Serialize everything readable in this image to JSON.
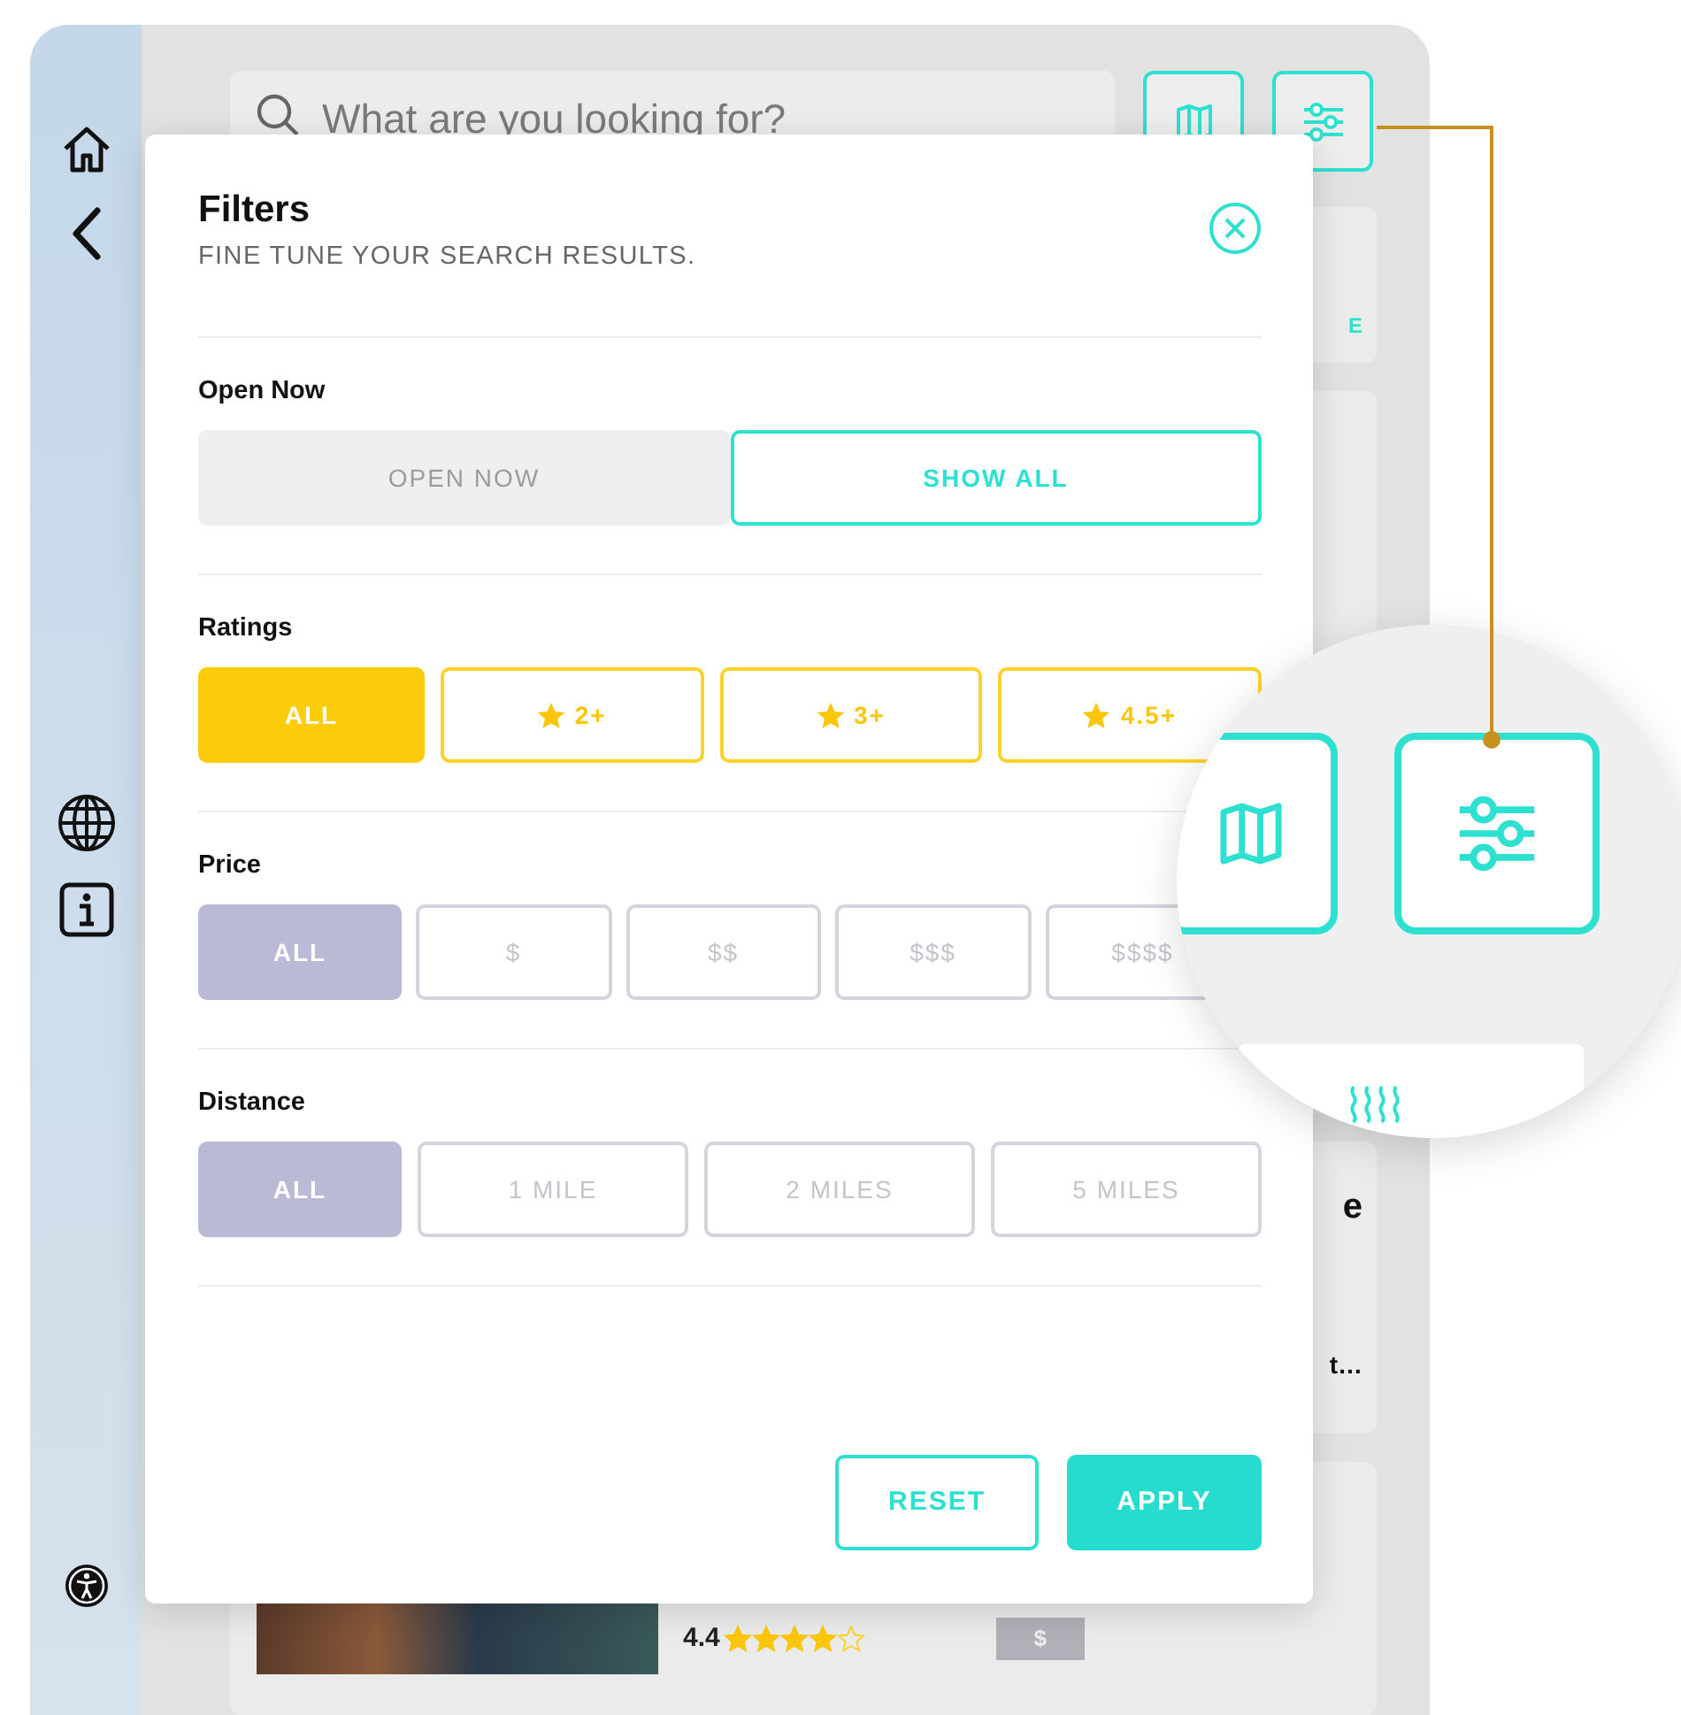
{
  "search": {
    "placeholder": "What are you looking for?"
  },
  "background_cards": [
    {
      "text": "E"
    },
    {
      "text": "e"
    },
    {
      "text": "t…"
    }
  ],
  "filters": {
    "title": "Filters",
    "subtitle": "FINE TUNE YOUR SEARCH RESULTS.",
    "sections": [
      {
        "label": "Open Now",
        "kind": "toggle",
        "options": [
          {
            "label": "OPEN NOW",
            "selected": false
          },
          {
            "label": "SHOW ALL",
            "selected": true
          }
        ]
      },
      {
        "label": "Ratings",
        "kind": "rating",
        "options": [
          {
            "label": "ALL",
            "kind": "plain",
            "selected": true
          },
          {
            "label": "2+",
            "kind": "star",
            "selected": false
          },
          {
            "label": "3+",
            "kind": "star",
            "selected": false
          },
          {
            "label": "4.5+",
            "kind": "star",
            "selected": false
          }
        ]
      },
      {
        "label": "Price",
        "kind": "choice",
        "options": [
          {
            "label": "ALL",
            "selected": true
          },
          {
            "label": "$",
            "selected": false
          },
          {
            "label": "$$",
            "selected": false
          },
          {
            "label": "$$$",
            "selected": false
          },
          {
            "label": "$$$$",
            "selected": false
          }
        ]
      },
      {
        "label": "Distance",
        "kind": "choice",
        "options": [
          {
            "label": "ALL",
            "selected": true
          },
          {
            "label": "1 MILE",
            "selected": false
          },
          {
            "label": "2 MILES",
            "selected": false
          },
          {
            "label": "5 MILES",
            "selected": false
          }
        ]
      }
    ],
    "buttons": [
      {
        "label": "RESET",
        "kind": "outline"
      },
      {
        "label": "APPLY",
        "kind": "solid"
      }
    ]
  },
  "result": {
    "rating": "4.4",
    "stars": 4,
    "price": "$"
  }
}
